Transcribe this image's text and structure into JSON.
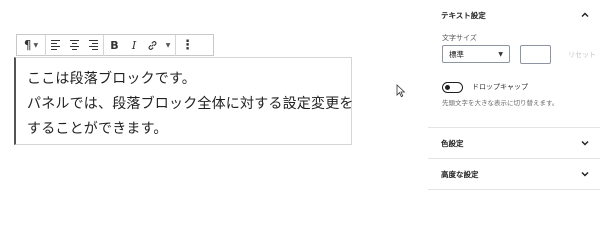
{
  "toolbar": {
    "paragraph_icon": "¶",
    "bold": "B",
    "italic": "I",
    "more_icon": "⋮"
  },
  "block": {
    "lines": [
      "ここは段落ブロックです。",
      "パネルでは、段落ブロック全体に対する設定変更を",
      "することができます。"
    ]
  },
  "sidebar": {
    "text_settings": {
      "title": "テキスト設定",
      "font_size_label": "文字サイズ",
      "font_size_value": "標準",
      "reset_label": "リセット",
      "drop_cap_label": "ドロップキャップ",
      "help_text": "先頭文字を大きな表示に切り替えます。"
    },
    "color_settings": {
      "title": "色設定"
    },
    "advanced_settings": {
      "title": "高度な設定"
    }
  },
  "colors": {
    "border": "#c8c8c8",
    "block_accent": "#555555",
    "text": "#1e1e1e"
  }
}
